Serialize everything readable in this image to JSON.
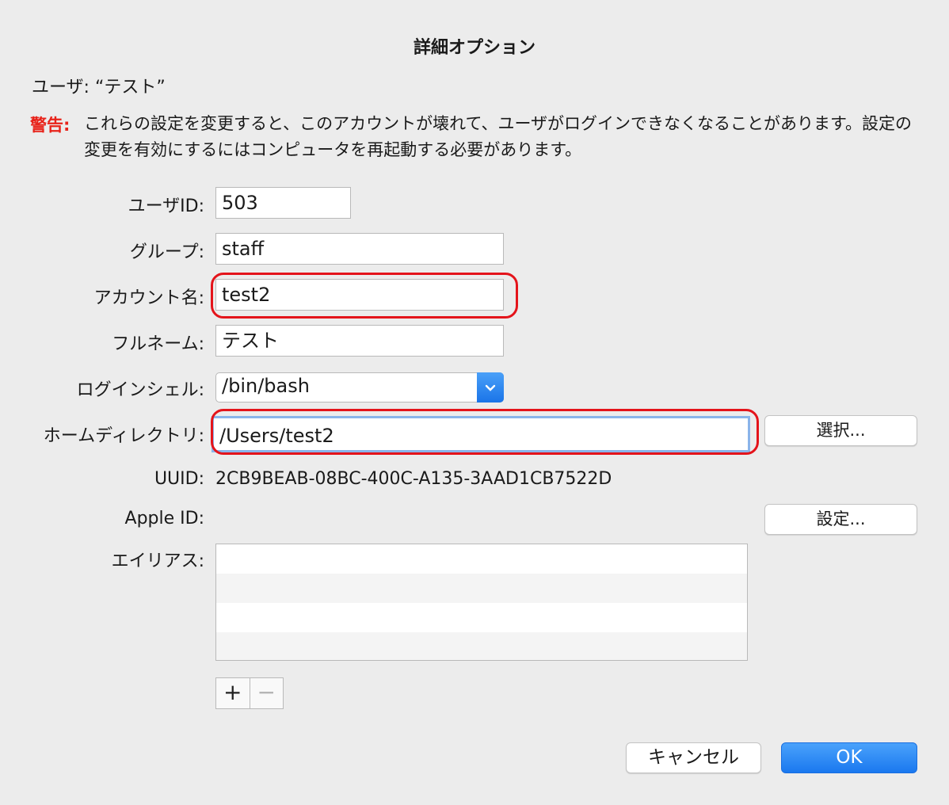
{
  "dialog": {
    "title": "詳細オプション",
    "user_line": "ユーザ: “テスト”",
    "warning_label": "警告:",
    "warning_text": "これらの設定を変更すると、このアカウントが壊れて、ユーザがログインできなくなることがあります。設定の変更を有効にするにはコンピュータを再起動する必要があります。"
  },
  "fields": {
    "user_id": {
      "label": "ユーザID:",
      "value": "503"
    },
    "group": {
      "label": "グループ:",
      "value": "staff"
    },
    "account_name": {
      "label": "アカウント名:",
      "value": "test2"
    },
    "full_name": {
      "label": "フルネーム:",
      "value": "テスト"
    },
    "login_shell": {
      "label": "ログインシェル:",
      "value": "/bin/bash"
    },
    "home_directory": {
      "label": "ホームディレクトリ:",
      "value": "/Users/test2"
    },
    "uuid": {
      "label": "UUID:",
      "value": "2CB9BEAB-08BC-400C-A135-3AAD1CB7522D"
    },
    "apple_id": {
      "label": "Apple ID:"
    },
    "aliases": {
      "label": "エイリアス:"
    }
  },
  "buttons": {
    "choose": "選択...",
    "setup": "設定...",
    "add": "+",
    "remove": "−",
    "cancel": "キャンセル",
    "ok": "OK"
  },
  "icons": {
    "dropdown": "chevron-down-icon"
  },
  "colors": {
    "warning": "#e8231a",
    "annotation_ring": "#e4141b",
    "accent": "#1a78ef"
  }
}
